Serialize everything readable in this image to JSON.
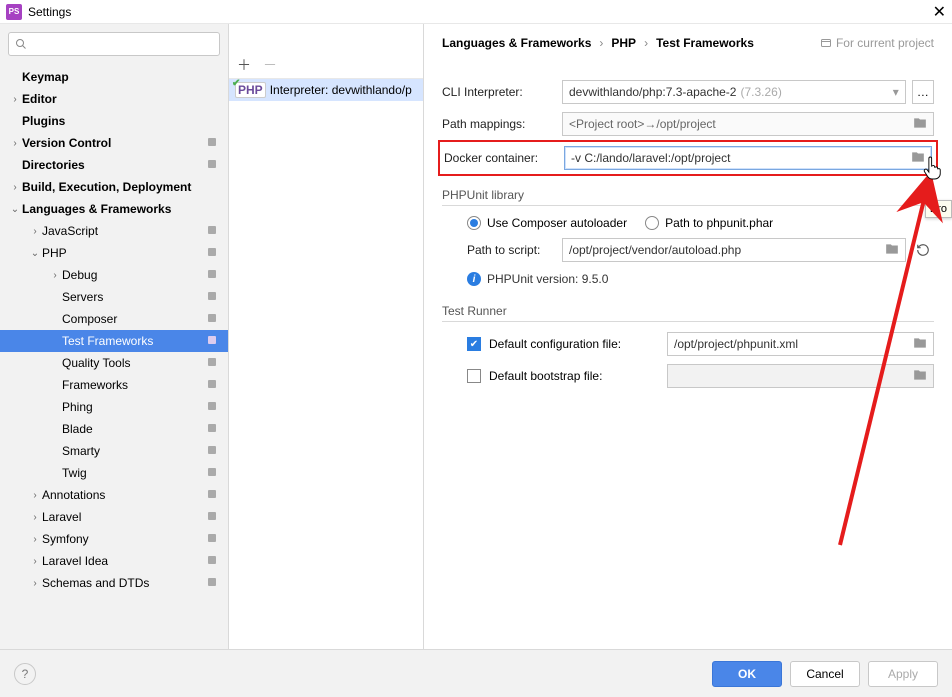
{
  "window": {
    "title": "Settings"
  },
  "search": {
    "placeholder": ""
  },
  "sidebar": {
    "items": [
      {
        "label": "Keymap",
        "level": 0,
        "bold": true,
        "chev": ""
      },
      {
        "label": "Editor",
        "level": 0,
        "bold": true,
        "chev": "›"
      },
      {
        "label": "Plugins",
        "level": 0,
        "bold": true,
        "chev": ""
      },
      {
        "label": "Version Control",
        "level": 0,
        "bold": true,
        "chev": "›",
        "cfg": true
      },
      {
        "label": "Directories",
        "level": 0,
        "bold": true,
        "chev": "",
        "cfg": true
      },
      {
        "label": "Build, Execution, Deployment",
        "level": 0,
        "bold": true,
        "chev": "›"
      },
      {
        "label": "Languages & Frameworks",
        "level": 0,
        "bold": true,
        "chev": "⌄"
      },
      {
        "label": "JavaScript",
        "level": 1,
        "chev": "›",
        "cfg": true
      },
      {
        "label": "PHP",
        "level": 1,
        "chev": "⌄",
        "cfg": true
      },
      {
        "label": "Debug",
        "level": 2,
        "chev": "›",
        "cfg": true
      },
      {
        "label": "Servers",
        "level": 2,
        "chev": "",
        "cfg": true
      },
      {
        "label": "Composer",
        "level": 2,
        "chev": "",
        "cfg": true
      },
      {
        "label": "Test Frameworks",
        "level": 2,
        "chev": "",
        "cfg": true,
        "selected": true
      },
      {
        "label": "Quality Tools",
        "level": 2,
        "chev": "",
        "cfg": true
      },
      {
        "label": "Frameworks",
        "level": 2,
        "chev": "",
        "cfg": true
      },
      {
        "label": "Phing",
        "level": 2,
        "chev": "",
        "cfg": true
      },
      {
        "label": "Blade",
        "level": 2,
        "chev": "",
        "cfg": true
      },
      {
        "label": "Smarty",
        "level": 2,
        "chev": "",
        "cfg": true
      },
      {
        "label": "Twig",
        "level": 2,
        "chev": "",
        "cfg": true
      },
      {
        "label": "Annotations",
        "level": 1,
        "chev": "›",
        "cfg": true
      },
      {
        "label": "Laravel",
        "level": 1,
        "chev": "›",
        "cfg": true
      },
      {
        "label": "Symfony",
        "level": 1,
        "chev": "›",
        "cfg": true
      },
      {
        "label": "Laravel Idea",
        "level": 1,
        "chev": "›",
        "cfg": true
      },
      {
        "label": "Schemas and DTDs",
        "level": 1,
        "chev": "›",
        "cfg": true
      }
    ]
  },
  "midlist": {
    "row0": "Interpreter: devwithlando/p",
    "badge": "PHP"
  },
  "breadcrumb": {
    "a": "Languages & Frameworks",
    "b": "PHP",
    "c": "Test Frameworks",
    "proj": "For current project"
  },
  "form": {
    "cli_label": "CLI Interpreter:",
    "cli_value": "devwithlando/php:7.3-apache-2",
    "cli_version": "(7.3.26)",
    "path_map_label": "Path mappings:",
    "path_map_value": "<Project root>→/opt/project",
    "docker_label": "Docker container:",
    "docker_value": "-v C:/lando/laravel:/opt/project",
    "tooltip": "Bro"
  },
  "phpunit": {
    "section": "PHPUnit library",
    "opt_composer": "Use Composer autoloader",
    "opt_phar": "Path to phpunit.phar",
    "script_label": "Path to script:",
    "script_value": "/opt/project/vendor/autoload.php",
    "version_label": "PHPUnit version: 9.5.0"
  },
  "runner": {
    "section": "Test Runner",
    "cfg_label": "Default configuration file:",
    "cfg_value": "/opt/project/phpunit.xml",
    "boot_label": "Default bootstrap file:"
  },
  "footer": {
    "ok": "OK",
    "cancel": "Cancel",
    "apply": "Apply"
  }
}
